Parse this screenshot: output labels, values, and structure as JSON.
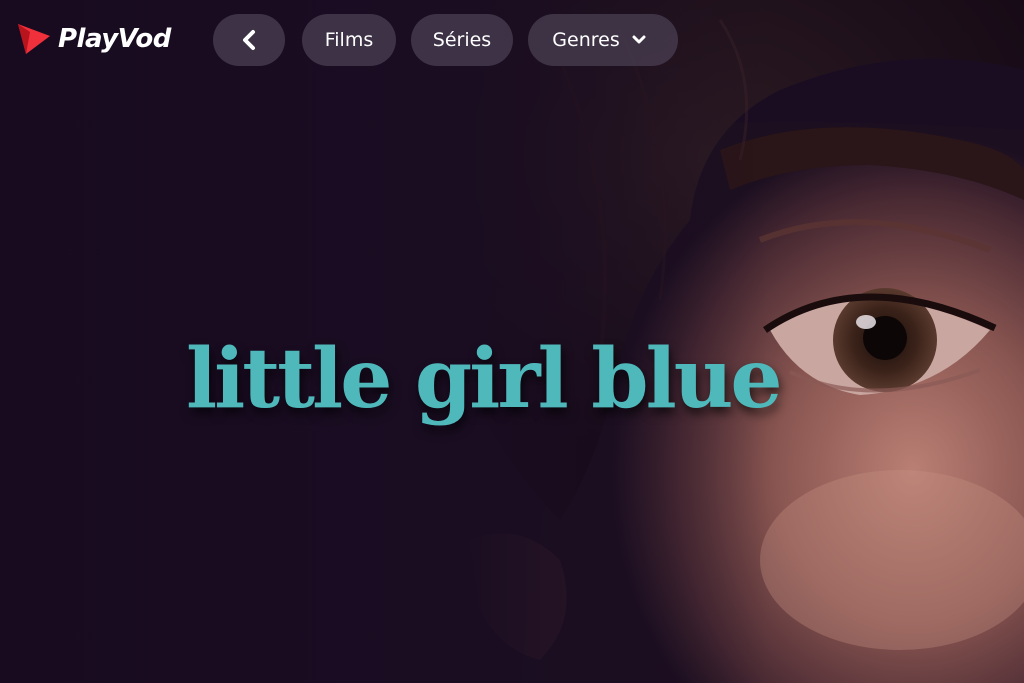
{
  "brand": {
    "name": "PlayVod",
    "accent_color": "#f0303a",
    "logo_icon": "play-triangle-icon"
  },
  "nav": {
    "back_icon": "chevron-left-icon",
    "items": [
      {
        "label": "Films"
      },
      {
        "label": "Séries"
      },
      {
        "label": "Genres",
        "icon": "chevron-down-icon"
      }
    ]
  },
  "hero": {
    "title": "little girl blue",
    "title_color": "#4fb8bb",
    "background_color": "#1a0d22"
  }
}
